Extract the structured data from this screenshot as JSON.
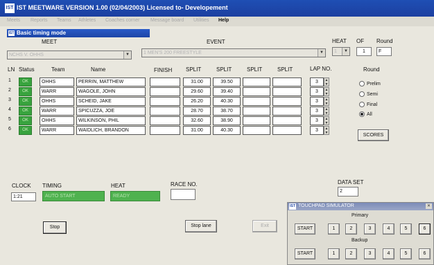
{
  "window_title": "IST MEETWARE VERSION 1.00 (02/04/2003) Licensed to- Developement",
  "menu": [
    "Meets",
    "Reports",
    "Teams",
    "Athletes",
    "Coaches corner",
    "Message board",
    "Utilities",
    "Help"
  ],
  "mode_title": "Basic timing mode",
  "meet": {
    "label": "MEET",
    "value": "NCHS V. OHHS"
  },
  "event": {
    "label": "EVENT",
    "value": "1  MEN'S      200 FREESTYLE"
  },
  "heat": {
    "label": "HEAT",
    "value": "1"
  },
  "of": {
    "label": "OF",
    "value": "1"
  },
  "round_field": {
    "label": "Round",
    "value": "F"
  },
  "columns": [
    "LN",
    "Status",
    "Team",
    "Name",
    "FINISH",
    "SPLIT",
    "SPLIT",
    "SPLIT",
    "SPLIT",
    "LAP NO."
  ],
  "lanes": [
    {
      "ln": "1",
      "status": "OK",
      "team": "OHHS",
      "name": "PERRIN, MATTHEW",
      "finish": "",
      "s1": "31.00",
      "s2": "39.50",
      "s3": "",
      "s4": "",
      "lap": "3"
    },
    {
      "ln": "2",
      "status": "OK",
      "team": "WARR",
      "name": "WAGOLE, JOHN",
      "finish": "",
      "s1": "29.60",
      "s2": "39.40",
      "s3": "",
      "s4": "",
      "lap": "3"
    },
    {
      "ln": "3",
      "status": "OK",
      "team": "OHHS",
      "name": "SCHEID, JAKE",
      "finish": "",
      "s1": "26.20",
      "s2": "40.30",
      "s3": "",
      "s4": "",
      "lap": "3"
    },
    {
      "ln": "4",
      "status": "OK",
      "team": "WARR",
      "name": "SPICUZZA, JOE",
      "finish": "",
      "s1": "28.70",
      "s2": "38.70",
      "s3": "",
      "s4": "",
      "lap": "3"
    },
    {
      "ln": "5",
      "status": "OK",
      "team": "OHHS",
      "name": "WILKINSON, PHIL",
      "finish": "",
      "s1": "32.60",
      "s2": "38.90",
      "s3": "",
      "s4": "",
      "lap": "3"
    },
    {
      "ln": "6",
      "status": "OK",
      "team": "WARR",
      "name": "WAIDLICH, BRANDON",
      "finish": "",
      "s1": "31.00",
      "s2": "40.30",
      "s3": "",
      "s4": "",
      "lap": "3"
    }
  ],
  "round_group": {
    "label": "Round",
    "options": [
      "Prelim",
      "Semi",
      "Final",
      "All"
    ],
    "selected": "All"
  },
  "scores_button": "SCORES",
  "clock": {
    "label": "CLOCK",
    "value": "1:21"
  },
  "timing": {
    "label": "TIMING",
    "value": "AUTO START"
  },
  "heat_status": {
    "label": "HEAT",
    "value": "READY"
  },
  "race_no": {
    "label": "RACE NO.",
    "value": ""
  },
  "data_set": {
    "label": "DATA SET",
    "value": "2"
  },
  "buttons": {
    "stop": "Stop",
    "stop_lane": "Stop lane",
    "exit": "Exit"
  },
  "touchpad": {
    "title": "TOUCHPAD SIMULATOR",
    "primary_label": "Primary",
    "backup_label": "Backup",
    "start": "START",
    "lanes": [
      "1",
      "2",
      "3",
      "4",
      "5",
      "6"
    ]
  },
  "colors": {
    "title_bar": "#1f4fb4",
    "status_ok": "#38a33e",
    "indicator": "#4fb24f"
  }
}
